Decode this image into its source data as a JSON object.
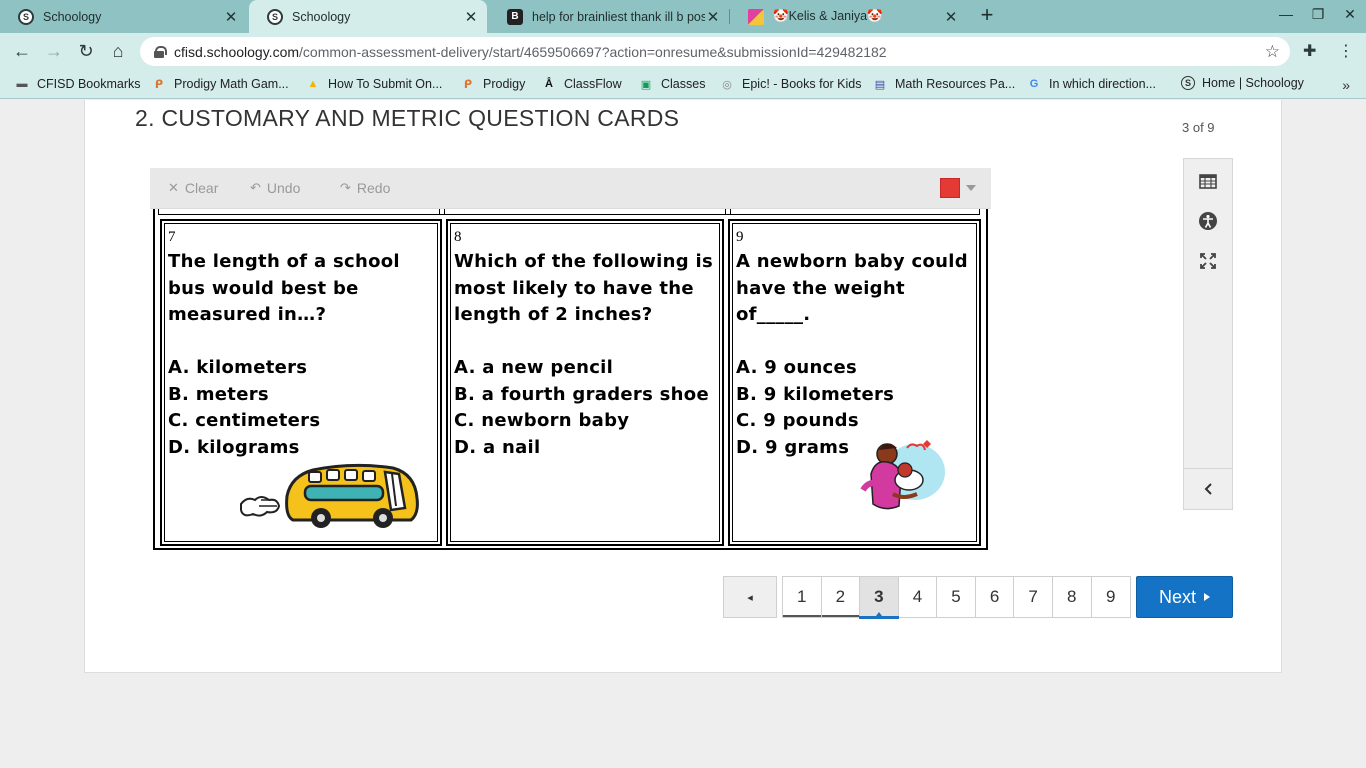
{
  "browser": {
    "tabs": [
      {
        "title": "Schoology",
        "active": false,
        "favicon": "schoology-icon"
      },
      {
        "title": "Schoology",
        "active": true,
        "favicon": "schoology-icon"
      },
      {
        "title": "help for brainliest thank ill b post",
        "active": false,
        "favicon": "brainly-icon"
      },
      {
        "title": "🤡Kelis & Janiya🤡",
        "active": false,
        "favicon": "jamboard-icon"
      }
    ],
    "url_host": "cfisd.schoology.com",
    "url_path": "/common-assessment-delivery/start/4659506697?action=onresume&submissionId=429482182",
    "bookmarks": [
      {
        "label": "CFISD Bookmarks",
        "icon": "folder-icon"
      },
      {
        "label": "Prodigy Math Gam...",
        "icon": "prodigy-icon"
      },
      {
        "label": "How To Submit On...",
        "icon": "drive-icon"
      },
      {
        "label": "Prodigy",
        "icon": "prodigy-icon"
      },
      {
        "label": "ClassFlow",
        "icon": "classflow-icon"
      },
      {
        "label": "Classes",
        "icon": "classroom-icon"
      },
      {
        "label": "Epic! - Books for Kids",
        "icon": "epic-icon"
      },
      {
        "label": "Math Resources Pa...",
        "icon": "page-icon"
      },
      {
        "label": "In which direction...",
        "icon": "google-icon"
      },
      {
        "label": "Home | Schoology",
        "icon": "schoology-icon"
      }
    ]
  },
  "assessment": {
    "question_title": "2. CUSTOMARY AND METRIC QUESTION CARDS",
    "progress": "3 of 9",
    "draw_toolbar": {
      "clear": "Clear",
      "undo": "Undo",
      "redo": "Redo",
      "pen_color": "#e53935"
    },
    "cards": [
      {
        "number": "7",
        "question": "The length of a school bus would best be measured in…?",
        "options": [
          "A. kilometers",
          "B. meters",
          "C. centimeters",
          "D. kilograms"
        ],
        "clipart": "school-bus-clipart"
      },
      {
        "number": "8",
        "question": "Which of the following is most likely to have the length of 2 inches?",
        "options": [
          "A. a new pencil",
          "B. a fourth graders shoe",
          "C. newborn baby",
          "D. a nail"
        ],
        "clipart": ""
      },
      {
        "number": "9",
        "question": "A newborn baby could have the weight of_____.",
        "options": [
          "A. 9 ounces",
          "B. 9 kilometers",
          "C. 9 pounds",
          "D. 9 grams"
        ],
        "clipart": "mother-baby-clipart"
      }
    ],
    "side_tools": [
      "calendar-icon",
      "accessibility-icon",
      "fullscreen-icon",
      "collapse-left-icon"
    ],
    "pagination": {
      "pages": [
        "1",
        "2",
        "3",
        "4",
        "5",
        "6",
        "7",
        "8",
        "9"
      ],
      "current": "3",
      "prev_label": "◂",
      "next_label": "Next"
    }
  }
}
